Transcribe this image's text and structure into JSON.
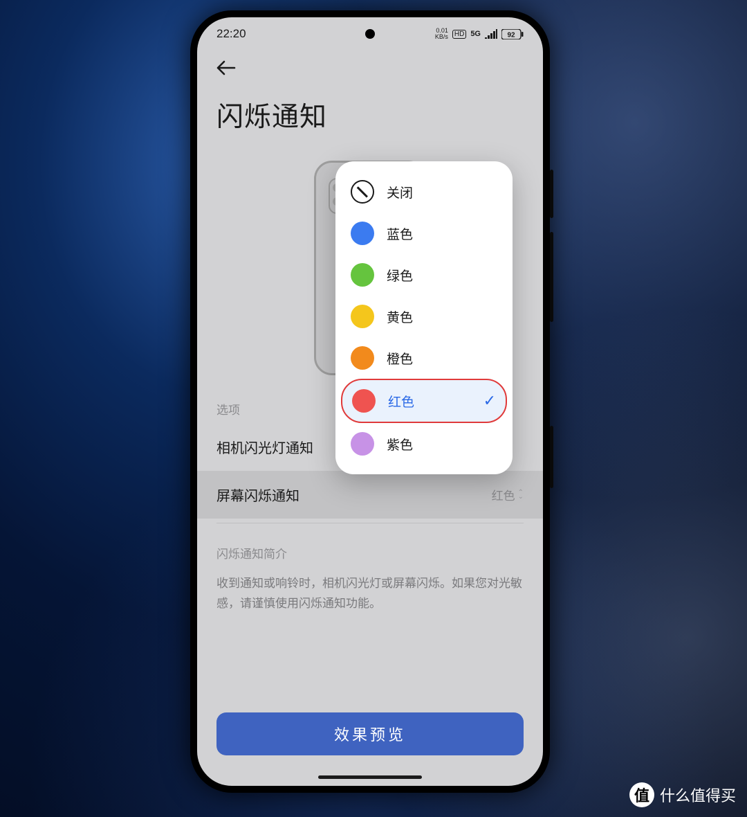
{
  "statusbar": {
    "time": "22:20",
    "kbps": "0.01",
    "kbps_unit": "KB/s",
    "hd": "HD",
    "net": "5G",
    "battery": "92"
  },
  "page": {
    "title": "闪烁通知",
    "options_label": "选项",
    "row_camera": "相机闪光灯通知",
    "row_screen": "屏幕闪烁通知",
    "row_screen_value": "红色",
    "info_title": "闪烁通知简介",
    "info_body": "收到通知或响铃时，相机闪光灯或屏幕闪烁。如果您对光敏感，请谨慎使用闪烁通知功能。",
    "preview_button": "效果预览"
  },
  "popup": {
    "items": [
      {
        "label": "关闭",
        "type": "off",
        "color": null,
        "selected": false
      },
      {
        "label": "蓝色",
        "type": "color",
        "color": "#3b7bf0",
        "selected": false
      },
      {
        "label": "绿色",
        "type": "color",
        "color": "#65c43e",
        "selected": false
      },
      {
        "label": "黄色",
        "type": "color",
        "color": "#f4c61c",
        "selected": false
      },
      {
        "label": "橙色",
        "type": "color",
        "color": "#f28a1c",
        "selected": false
      },
      {
        "label": "红色",
        "type": "color",
        "color": "#ef5350",
        "selected": true
      },
      {
        "label": "紫色",
        "type": "color",
        "color": "#c792e6",
        "selected": false
      }
    ]
  },
  "watermark": {
    "badge": "值",
    "text": "什么值得买"
  }
}
